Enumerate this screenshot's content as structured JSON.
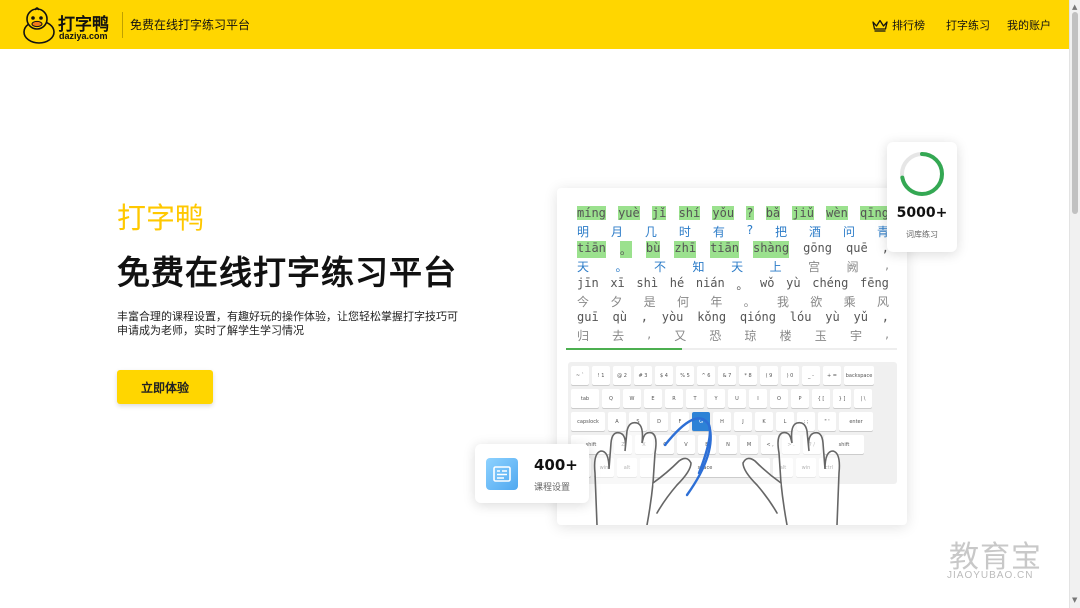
{
  "header": {
    "logo_cn": "打字鸭",
    "logo_en": "daziya.com",
    "slogan": "免费在线打字练习平台",
    "nav": {
      "rank": "排行榜",
      "practice": "打字练习",
      "account": "我的账户"
    },
    "colors": {
      "brand": "#FFD600"
    }
  },
  "hero": {
    "brand": "打字鸭",
    "title": "免费在线打字练习平台",
    "desc": "丰富合理的课程设置，有趣好玩的操作体验，让您轻松掌握打字技巧可申请成为老师，实时了解学生学习情况",
    "cta": "立即体验"
  },
  "illustration": {
    "lines": [
      {
        "pinyin": [
          "míng",
          "yuè",
          "jǐ",
          "shí",
          "yǒu",
          "?",
          "bǎ",
          "jiǔ",
          "wèn",
          "qīng"
        ],
        "hanzi": [
          "明",
          "月",
          "几",
          "时",
          "有",
          "?",
          "把",
          "酒",
          "问",
          "青"
        ],
        "done": 10
      },
      {
        "pinyin": [
          "tiān",
          "。",
          "bù",
          "zhī",
          "tiān",
          "shàng",
          "gōng",
          "quē",
          ","
        ],
        "hanzi": [
          "天",
          "。",
          "不",
          "知",
          "天",
          "上",
          "宫",
          "阙",
          ","
        ],
        "done": 6
      },
      {
        "pinyin": [
          "jīn",
          "xī",
          "shì",
          "hé",
          "nián",
          "。",
          "wǒ",
          "yù",
          "chéng",
          "fēng"
        ],
        "hanzi": [
          "今",
          "夕",
          "是",
          "何",
          "年",
          "。",
          "我",
          "欲",
          "乘",
          "风"
        ],
        "done": 0
      },
      {
        "pinyin": [
          "guī",
          "qù",
          ",",
          "yòu",
          "kǒng",
          "qióng",
          "lóu",
          "yù",
          "yǔ",
          ","
        ],
        "hanzi": [
          "归",
          "去",
          ",",
          "又",
          "恐",
          "琼",
          "楼",
          "玉",
          "宇",
          ","
        ],
        "done": 0
      }
    ],
    "progress": 0.35,
    "keyboard": {
      "rows": [
        [
          "~ `",
          "! 1",
          "@ 2",
          "# 3",
          "$ 4",
          "% 5",
          "^ 6",
          "& 7",
          "* 8",
          "( 9",
          ") 0",
          "_ -",
          "+ =",
          "backspace"
        ],
        [
          "tab",
          "Q",
          "W",
          "E",
          "R",
          "T",
          "Y",
          "U",
          "I",
          "O",
          "P",
          "{ [",
          "} ]",
          "| \\"
        ],
        [
          "capslock",
          "A",
          "S",
          "D",
          "F",
          "G",
          "H",
          "J",
          "K",
          "L",
          ": ;",
          "\" '",
          "enter"
        ],
        [
          "shift",
          "Z",
          "X",
          "C",
          "V",
          "B",
          "N",
          "M",
          "< ,",
          "> .",
          "? /",
          "shift"
        ],
        [
          "ctrl",
          "win",
          "alt",
          "space",
          "alt",
          "win",
          "ctrl"
        ]
      ],
      "highlight": "G"
    },
    "colors": {
      "done_bg": "#9BE18E",
      "done_text": "#2C7CC8",
      "key_highlight": "#2D82D6"
    }
  },
  "stats": {
    "words": {
      "value": "5000+",
      "label": "词库练习",
      "ring_fraction": 0.72
    },
    "courses": {
      "value": "400+",
      "label": "课程设置"
    }
  },
  "watermark": {
    "cn": "教育宝",
    "en": "JIAOYUBAO.CN"
  }
}
